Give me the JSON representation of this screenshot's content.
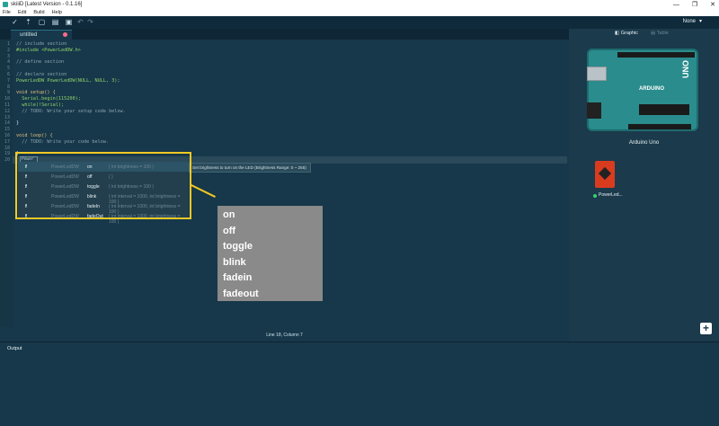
{
  "window": {
    "title": "skiiiD [Latest Version - 0.1.16]",
    "controls": [
      "—",
      "❐",
      "✕"
    ]
  },
  "menu": [
    "File",
    "Edit",
    "Build",
    "Help"
  ],
  "toolbar": {
    "icons": [
      "check-icon",
      "upload-icon",
      "new-file-icon",
      "open-folder-icon",
      "save-icon",
      "undo-icon",
      "redo-icon"
    ],
    "glyphs": [
      "✓",
      "⇡",
      "▢",
      "▤",
      "▣",
      "↶",
      "↷"
    ],
    "board_select": "None",
    "board_select_chevron": "▾"
  },
  "editor": {
    "tab_label": "untitled",
    "typed_text": "Power",
    "lines": [
      {
        "n": "1",
        "text": "// include section",
        "cls": "cm"
      },
      {
        "n": "2",
        "text": "#include <PowerLedDW.h>",
        "cls": "grn"
      },
      {
        "n": "3",
        "text": "",
        "cls": ""
      },
      {
        "n": "4",
        "text": "// define section",
        "cls": "cm"
      },
      {
        "n": "5",
        "text": "",
        "cls": ""
      },
      {
        "n": "6",
        "text": "// declare section",
        "cls": "cm"
      },
      {
        "n": "7",
        "text": "PowerLedDW PowerLedDW(NULL, NULL, 3);",
        "cls": "grn"
      },
      {
        "n": "8",
        "text": "",
        "cls": ""
      },
      {
        "n": "9",
        "text": "void setup() {",
        "cls": "kw"
      },
      {
        "n": "10",
        "text": "  Serial.begin(115200);",
        "cls": "grn"
      },
      {
        "n": "11",
        "text": "  while(!Serial);",
        "cls": "grn"
      },
      {
        "n": "12",
        "text": "  // TODO: Write your setup code below.",
        "cls": "cm"
      },
      {
        "n": "13",
        "text": "",
        "cls": ""
      },
      {
        "n": "14",
        "text": "}",
        "cls": ""
      },
      {
        "n": "15",
        "text": "",
        "cls": ""
      },
      {
        "n": "16",
        "text": "void loop() {",
        "cls": "kw"
      },
      {
        "n": "17",
        "text": "  // TODO: Write your code below.",
        "cls": "cm"
      },
      {
        "n": "18",
        "text": "",
        "cls": ""
      },
      {
        "n": "19",
        "text": "}",
        "cls": ""
      },
      {
        "n": "20",
        "text": "",
        "cls": ""
      }
    ]
  },
  "autocomplete": {
    "items": [
      {
        "kind": "f",
        "cls": "PowerLedDW",
        "name": "on",
        "sig": "( int brightness = 100 )"
      },
      {
        "kind": "f",
        "cls": "PowerLedDW",
        "name": "off",
        "sig": "( )"
      },
      {
        "kind": "f",
        "cls": "PowerLedDW",
        "name": "toggle",
        "sig": "( int brightness = 100 )"
      },
      {
        "kind": "f",
        "cls": "PowerLedDW",
        "name": "blink",
        "sig": "( int interval = 1000, int brightness = 100 )"
      },
      {
        "kind": "f",
        "cls": "PowerLedDW",
        "name": "fadeIn",
        "sig": "( int interval = 1000, int brightness = 100 )"
      },
      {
        "kind": "f",
        "cls": "PowerLedDW",
        "name": "fadeOut",
        "sig": "( int interval = 1000, int brightness = 100 )"
      }
    ],
    "tooltip": "Set brightness to turn on the LED (Brightness Range: 0 ~ 255)"
  },
  "annotation": {
    "items": [
      "on",
      "off",
      "toggle",
      "blink",
      "fadein",
      "fadeout"
    ]
  },
  "status": {
    "cursor": "Line 18, Column 7"
  },
  "right_panel": {
    "tabs": [
      {
        "icon": "◧",
        "label": "Graphic"
      },
      {
        "icon": "▤",
        "label": "Table"
      }
    ],
    "board_name": "Arduino Uno",
    "board_text_uno": "UNO",
    "board_text_brand": "ARDUINO",
    "module_label": "PowerLed...",
    "add_button": "+"
  },
  "output": {
    "title": "Output"
  },
  "colors": {
    "accent_yellow": "#f2c924",
    "editor_bg": "#17384a",
    "module_red": "#d93b1f",
    "status_green": "#38d26e"
  }
}
